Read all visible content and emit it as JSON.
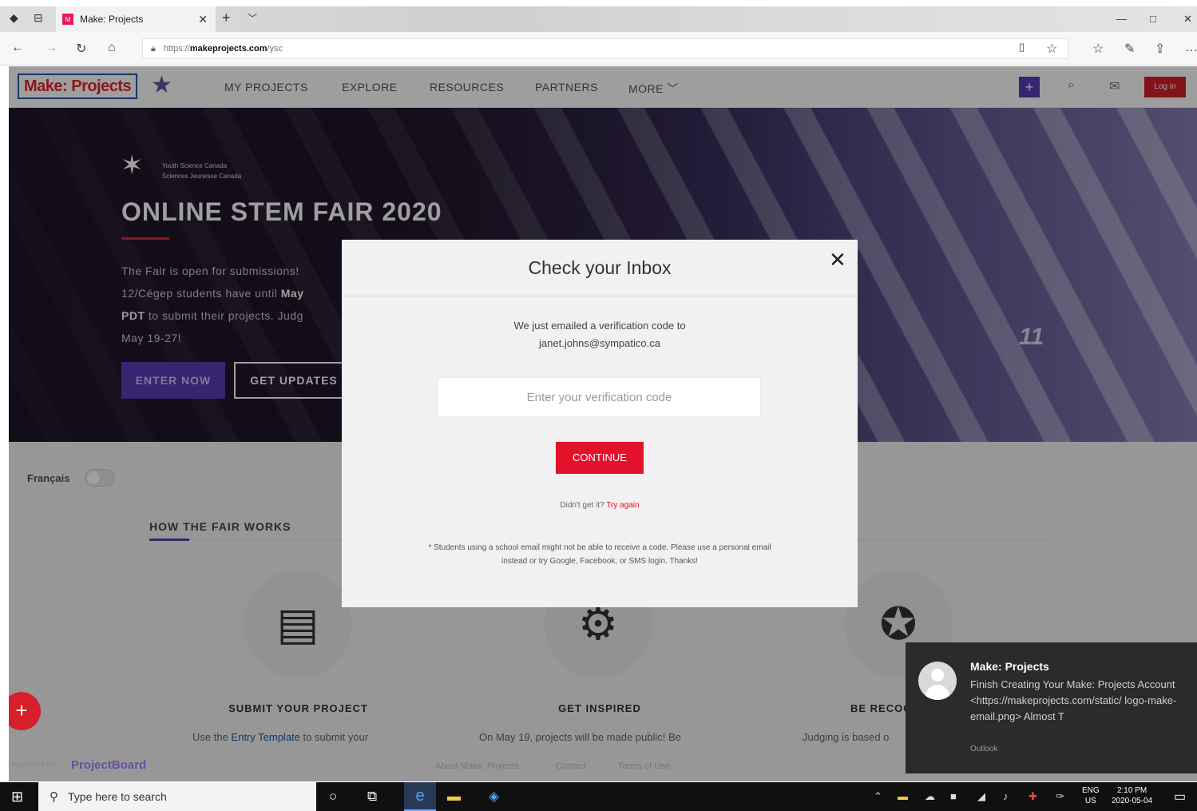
{
  "browser": {
    "tab_title": "Make: Projects",
    "tab_favicon": "M",
    "url_prefix": "https://",
    "url_host": "makeprojects.com",
    "url_path": "/ysc"
  },
  "site": {
    "logo_text": "Make: Projects",
    "nav": [
      "MY PROJECTS",
      "EXPLORE",
      "RESOURCES",
      "PARTNERS",
      "MORE ﹀"
    ],
    "login_label": "Log in"
  },
  "hero": {
    "sublogo_line1": "Youth Science Canada",
    "sublogo_line2": "Sciences Jeunesse Canada",
    "title": "ONLINE STEM FAIR 2020",
    "text_line1": "The Fair is open for submissions! ",
    "text_line2": "12/Cégep students have until ",
    "text_bold2": "May",
    "text_bold3": "PDT",
    "text_line3": " to submit their projects. Judg",
    "text_line4": "May 19-27!",
    "enter_label": "ENTER NOW",
    "updates_label": "GET UPDATES",
    "board_number": "11"
  },
  "lower": {
    "francais_label": "Français",
    "how_heading": "HOW THE FAIR WORKS",
    "steps": [
      {
        "title": "SUBMIT YOUR PROJECT",
        "text_pre": "Use the ",
        "text_link": "Entry Template",
        "text_post": " to submit your"
      },
      {
        "title": "GET INSPIRED",
        "text": "On May 19, projects will be made public! Be"
      },
      {
        "title": "BE RECOG",
        "text": "Judging is based o"
      }
    ],
    "powered_by": "POWERED BY",
    "projectboard": "ProjectBoard",
    "footer_links": [
      "About Make: Projects",
      "Contact",
      "Terms of Use"
    ]
  },
  "modal": {
    "title": "Check your Inbox",
    "message_line1": "We just emailed a verification code to",
    "email": "janet.johns@sympatico.ca",
    "input_placeholder": "Enter your verification code",
    "continue_label": "CONTINUE",
    "retry_text": "Didn't get it? ",
    "retry_link": "Try again",
    "note": "* Students using a school email might not be able to receive a code. Please use a personal email instead or try Google, Facebook, or SMS login. Thanks!"
  },
  "toast": {
    "title": "Make: Projects",
    "body": "Finish Creating Your Make: Projects Account <https://makeprojects.com/static/ logo-make-email.png> Almost T",
    "source": "Outlook"
  },
  "taskbar": {
    "search_placeholder": "Type here to search",
    "lang_line1": "ENG",
    "lang_line2": "US",
    "time": "2:10 PM",
    "date": "2020-05-04"
  },
  "colors": {
    "brand_purple": "#5b3ab5",
    "brand_red": "#e4112a",
    "logo_blue": "#1e5ca8"
  }
}
